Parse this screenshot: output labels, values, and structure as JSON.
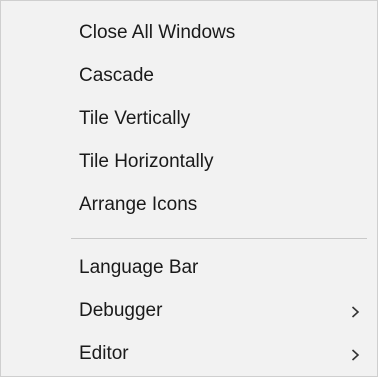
{
  "menu": {
    "items": [
      {
        "label": "Close All Windows",
        "submenu": false
      },
      {
        "label": "Cascade",
        "submenu": false
      },
      {
        "label": "Tile Vertically",
        "submenu": false
      },
      {
        "label": "Tile Horizontally",
        "submenu": false
      },
      {
        "label": "Arrange Icons",
        "submenu": false
      },
      {
        "label": "Language Bar",
        "submenu": false
      },
      {
        "label": "Debugger",
        "submenu": true,
        "submenu_icon": "chevron-right-icon"
      },
      {
        "label": "Editor",
        "submenu": true,
        "submenu_icon": "chevron-right-icon"
      }
    ],
    "colors": {
      "background": "#f2f2f2",
      "border": "#cfcfcf",
      "separator": "#c9c9c9",
      "text": "#1a1a1a"
    }
  }
}
